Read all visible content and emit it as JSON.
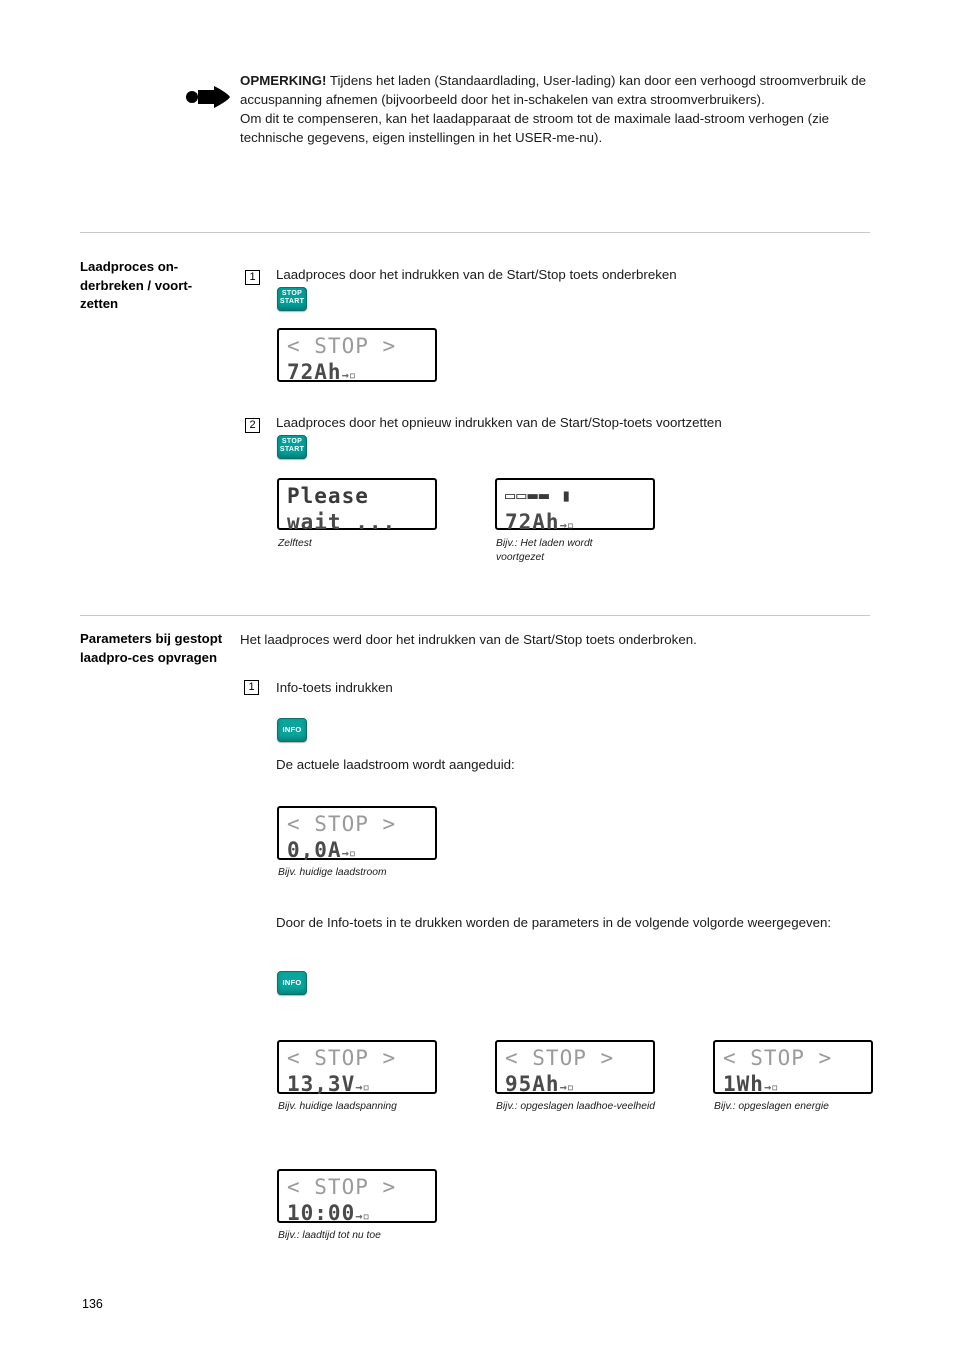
{
  "note": {
    "bold_lead": "OPMERKING!",
    "text": " Tijdens het laden (Standaardlading, User-lading) kan door een verhoogd stroomverbruik de accuspanning afnemen (bijvoorbeeld door het in-schakelen van extra stroomverbruikers).",
    "text2": "Om dit te compenseren, kan het laadapparaat de stroom tot de maximale laad-stroom verhogen (zie technische gegevens, eigen instellingen in het USER-me-nu).",
    "icon": "pointing-hand-icon"
  },
  "section1": {
    "label": "Laadproces on-derbreken / voort-zetten",
    "step1_num": "1",
    "step1_text": "Laadproces door het indrukken van de Start/Stop toets onderbreken",
    "step2_num": "2",
    "step2_text": "Laadproces door het opnieuw indrukken van de Start/Stop-toets voortzetten",
    "key_stop": "STOP",
    "key_start": "START",
    "lcd1": {
      "row1": "< STOP >",
      "row2": "72Ah",
      "arrow": "→▫"
    },
    "lcd2": {
      "row1": "Please",
      "row2": "wait ..."
    },
    "lcd2_caption": "Zelftest",
    "lcd3": {
      "glyph": "▭▭▬▬   ▮",
      "row2": "72Ah",
      "arrow": "→▫"
    },
    "lcd3_caption": "Bijv.: Het laden wordt voortgezet"
  },
  "section2": {
    "label": "Parameters bij gestopt laadpro-ces opvragen",
    "intro": "Het laadproces werd door het indrukken van de Start/Stop toets onderbroken.",
    "step1_num": "1",
    "step1_text": "Info-toets indrukken",
    "key_info": "INFO",
    "text_after_info": "De actuele laadstroom wordt aangeduid:",
    "lcd_current": {
      "row1": "< STOP >",
      "row2": "0,0A",
      "arrow": "→▫"
    },
    "caption_current": "Bijv. huidige laadstroom",
    "text_order": "Door de Info-toets in te drukken worden de parameters in de volgende volgorde weergegeven:",
    "lcd_voltage": {
      "row1": "< STOP >",
      "row2": "13,3V",
      "arrow": "→▫"
    },
    "caption_voltage": "Bijv. huidige laadspanning",
    "lcd_capacity": {
      "row1": "< STOP >",
      "row2": "95Ah",
      "arrow": "→▫"
    },
    "caption_capacity": "Bijv.: opgeslagen laadhoe-veelheid",
    "lcd_energy": {
      "row1": "< STOP >",
      "row2": "1Wh",
      "arrow": "→▫"
    },
    "caption_energy": "Bijv.: opgeslagen energie",
    "lcd_time": {
      "row1": "< STOP >",
      "row2": "10:00",
      "arrow": "→▫"
    },
    "caption_time": "Bijv.: laadtijd tot nu toe"
  },
  "footer": {
    "page_number": "136"
  }
}
